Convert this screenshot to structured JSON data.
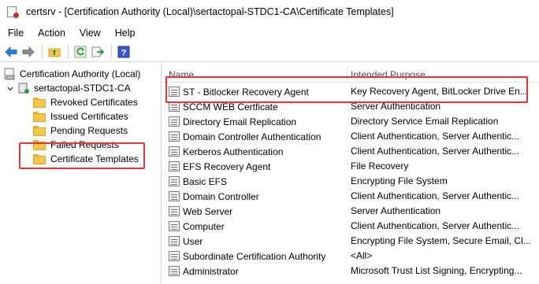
{
  "window": {
    "title": "certsrv - [Certification Authority (Local)\\sertactopal-STDC1-CA\\Certificate Templates]"
  },
  "menu": [
    "File",
    "Action",
    "View",
    "Help"
  ],
  "toolbar": {
    "icons": [
      "back-arrow-icon",
      "forward-arrow-icon",
      "up-folder-icon",
      "refresh-icon",
      "export-list-icon",
      "help-icon"
    ]
  },
  "tree": {
    "root": "Certification Authority (Local)",
    "ca": "sertactopal-STDC1-CA",
    "children": [
      "Revoked Certificates",
      "Issued Certificates",
      "Pending Requests",
      "Failed Requests",
      "Certificate Templates"
    ]
  },
  "list": {
    "columns": {
      "name": "Name",
      "purpose": "Intended Purpose"
    },
    "rows": [
      {
        "name": "ST - Bitlocker Recovery Agent",
        "purpose": "Key Recovery Agent, BitLocker Drive En..."
      },
      {
        "name": "SCCM WEB Certficate",
        "purpose": "Server Authentication"
      },
      {
        "name": "Directory Email Replication",
        "purpose": "Directory Service Email Replication"
      },
      {
        "name": "Domain Controller Authentication",
        "purpose": "Client Authentication, Server Authentic..."
      },
      {
        "name": "Kerberos Authentication",
        "purpose": "Client Authentication, Server Authentic..."
      },
      {
        "name": "EFS Recovery Agent",
        "purpose": "File Recovery"
      },
      {
        "name": "Basic EFS",
        "purpose": "Encrypting File System"
      },
      {
        "name": "Domain Controller",
        "purpose": "Client Authentication, Server Authentic..."
      },
      {
        "name": "Web Server",
        "purpose": "Server Authentication"
      },
      {
        "name": "Computer",
        "purpose": "Client Authentication, Server Authentic..."
      },
      {
        "name": "User",
        "purpose": "Encrypting File System, Secure Email, Cl..."
      },
      {
        "name": "Subordinate Certification Authority",
        "purpose": "<All>"
      },
      {
        "name": "Administrator",
        "purpose": "Microsoft Trust List Signing, Encrypting..."
      }
    ]
  },
  "colors": {
    "highlight": "#e8333a",
    "folder": "#f3c64f"
  }
}
